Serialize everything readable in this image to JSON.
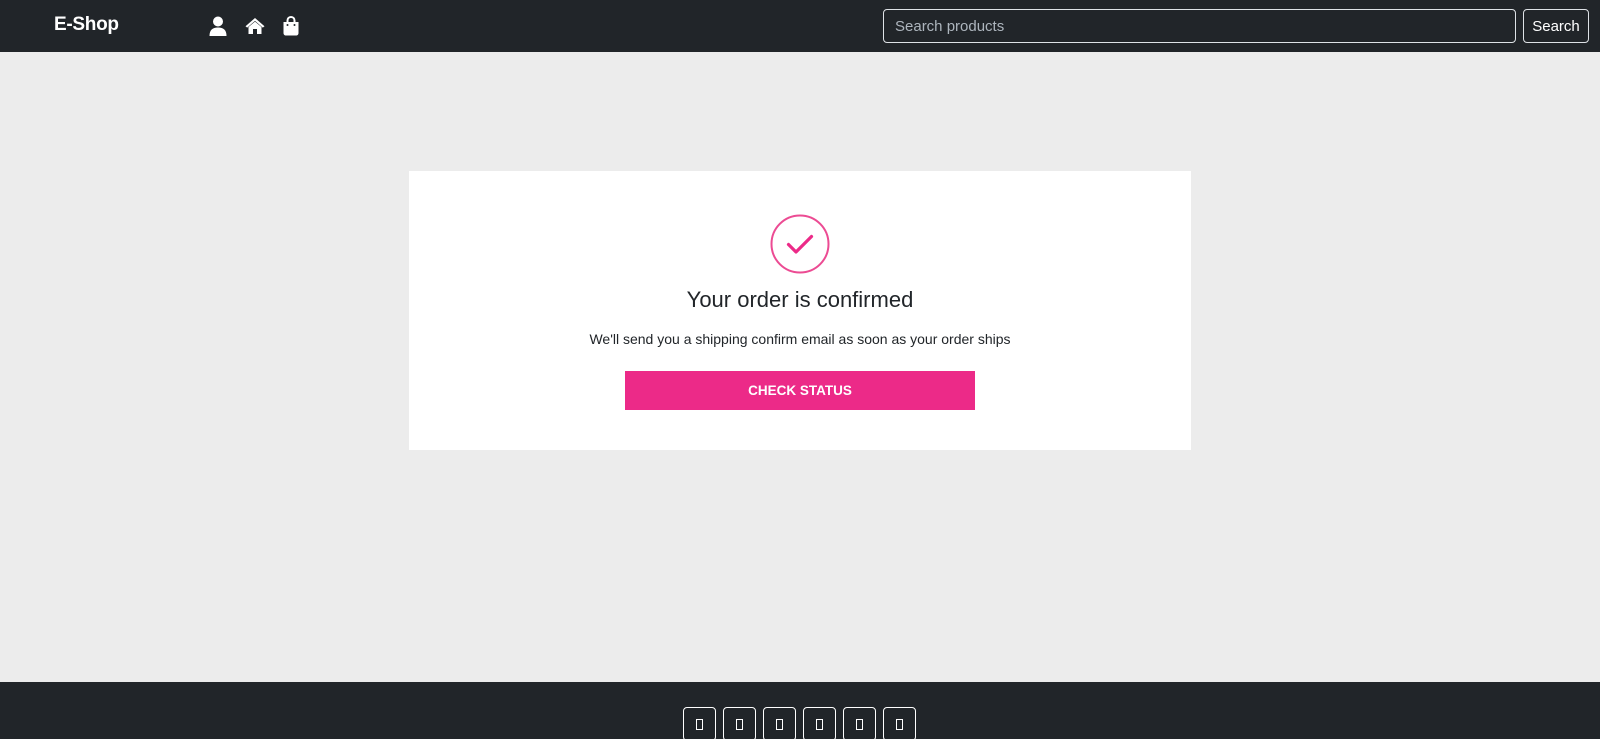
{
  "navbar": {
    "brand": "E-Shop",
    "icons": [
      "user-icon",
      "home-icon",
      "shopping-bag-icon"
    ],
    "search": {
      "placeholder": "Search products",
      "value": "",
      "button_label": "Search"
    }
  },
  "confirmation": {
    "icon": "check-circle-icon",
    "title": "Your order is confirmed",
    "message": "We'll send you a shipping confirm email as soon as your order ships",
    "button_label": "CHECK STATUS"
  },
  "footer": {
    "social_icons": [
      "social-icon-1",
      "social-icon-2",
      "social-icon-3",
      "social-icon-4",
      "social-icon-5",
      "social-icon-6"
    ]
  },
  "colors": {
    "navbar_bg": "#212529",
    "page_bg": "#ececec",
    "accent": "#ec2a88",
    "check_circle": "#ec4b93"
  }
}
